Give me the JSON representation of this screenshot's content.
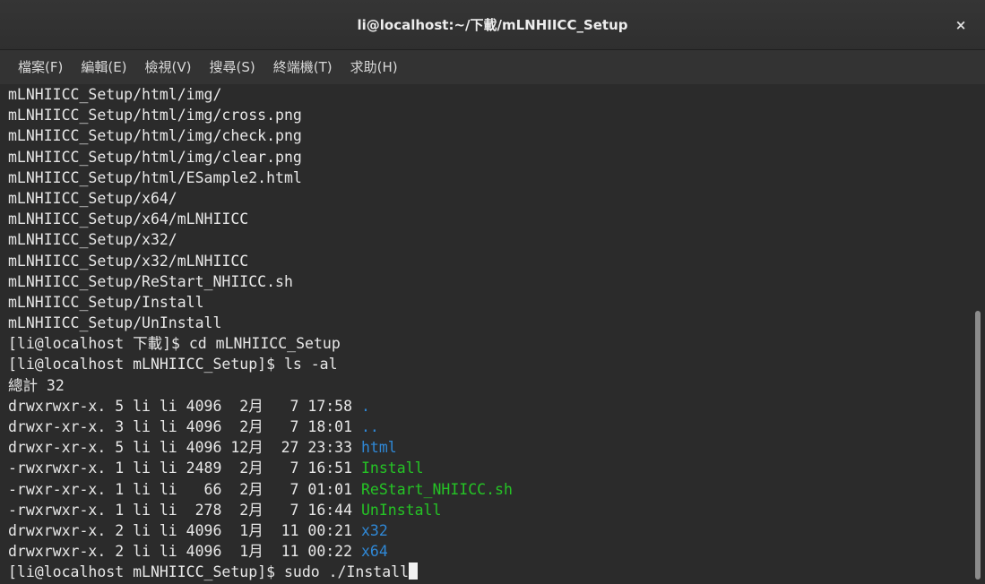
{
  "window": {
    "title": "li@localhost:~/下載/mLNHIICC_Setup",
    "close_label": "×"
  },
  "menu": [
    {
      "label": "檔案(F)"
    },
    {
      "label": "編輯(E)"
    },
    {
      "label": "檢視(V)"
    },
    {
      "label": "搜尋(S)"
    },
    {
      "label": "終端機(T)"
    },
    {
      "label": "求助(H)"
    }
  ],
  "terminal": {
    "lines": [
      "mLNHIICC_Setup/html/img/",
      "mLNHIICC_Setup/html/img/cross.png",
      "mLNHIICC_Setup/html/img/check.png",
      "mLNHIICC_Setup/html/img/clear.png",
      "mLNHIICC_Setup/html/ESample2.html",
      "mLNHIICC_Setup/x64/",
      "mLNHIICC_Setup/x64/mLNHIICC",
      "mLNHIICC_Setup/x32/",
      "mLNHIICC_Setup/x32/mLNHIICC",
      "mLNHIICC_Setup/ReStart_NHIICC.sh",
      "mLNHIICC_Setup/Install",
      "mLNHIICC_Setup/UnInstall",
      "[li@localhost 下載]$ cd mLNHIICC_Setup",
      "[li@localhost mLNHIICC_Setup]$ ls -al",
      "總計 32"
    ],
    "listing": [
      {
        "prefix": "drwxrwxr-x. 5 li li 4096  2月   7 17:58 ",
        "name": ".",
        "kind": "dir"
      },
      {
        "prefix": "drwxr-xr-x. 3 li li 4096  2月   7 18:01 ",
        "name": "..",
        "kind": "dir"
      },
      {
        "prefix": "drwxr-xr-x. 5 li li 4096 12月  27 23:33 ",
        "name": "html",
        "kind": "dir"
      },
      {
        "prefix": "-rwxrwxr-x. 1 li li 2489  2月   7 16:51 ",
        "name": "Install",
        "kind": "exe"
      },
      {
        "prefix": "-rwxr-xr-x. 1 li li   66  2月   7 01:01 ",
        "name": "ReStart_NHIICC.sh",
        "kind": "exe"
      },
      {
        "prefix": "-rwxrwxr-x. 1 li li  278  2月   7 16:44 ",
        "name": "UnInstall",
        "kind": "exe"
      },
      {
        "prefix": "drwxrwxr-x. 2 li li 4096  1月  11 00:21 ",
        "name": "x32",
        "kind": "dir"
      },
      {
        "prefix": "drwxrwxr-x. 2 li li 4096  1月  11 00:22 ",
        "name": "x64",
        "kind": "dir"
      }
    ],
    "prompt_line": "[li@localhost mLNHIICC_Setup]$ sudo ./Install"
  },
  "colors": {
    "directory": "#2f88d6",
    "executable": "#25c425",
    "text": "#e8e8e8",
    "background": "#2b2b2b"
  },
  "icons": {
    "close": "close-icon",
    "cursor": "block-cursor"
  }
}
